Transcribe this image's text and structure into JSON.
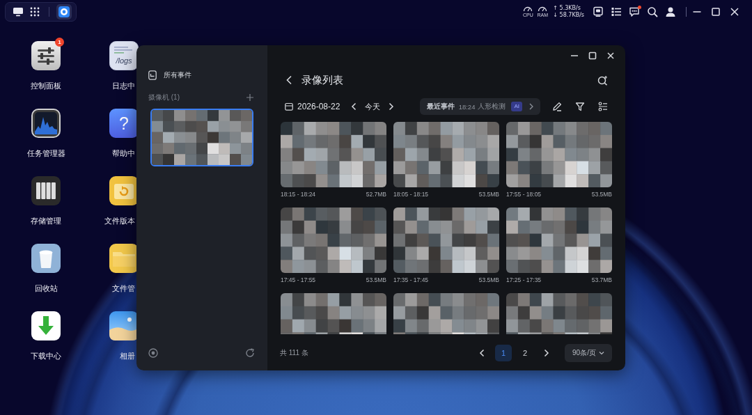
{
  "top_bar": {
    "cpu_label": "CPU",
    "ram_label": "RAM",
    "upload_speed": "↑ 5.3KB/s",
    "download_speed": "↓ 58.7KB/s",
    "messages_unread": true
  },
  "desktop": {
    "columns": [
      {
        "apps": [
          {
            "kind": "settings",
            "label": "控制面板",
            "badge": "1"
          },
          {
            "kind": "monitor",
            "label": "任务管理器"
          },
          {
            "kind": "storage",
            "label": "存储管理"
          },
          {
            "kind": "trash",
            "label": "回收站"
          },
          {
            "kind": "download",
            "label": "下载中心"
          }
        ]
      },
      {
        "apps": [
          {
            "kind": "logs",
            "label": "日志中",
            "icon_text": "/logs"
          },
          {
            "kind": "help",
            "label": "帮助中",
            "icon_text": "?"
          },
          {
            "kind": "versions",
            "label": "文件版本"
          },
          {
            "kind": "files",
            "label": "文件管"
          },
          {
            "kind": "photos",
            "label": "相册"
          }
        ]
      }
    ]
  },
  "window": {
    "sidebar": {
      "all_events": "所有事件",
      "camera_heading": "摄像机 (1)",
      "cameras": [
        {
          "selected": true
        }
      ]
    },
    "main": {
      "title": "录像列表",
      "date": "2026-08-22",
      "today": "今天",
      "recent_event": {
        "label": "最近事件",
        "time": "18:24",
        "type": "人形检测",
        "badge": "AI"
      },
      "recordings": [
        {
          "time": "18:15 - 18:24",
          "size": "52.7MB",
          "cut_off": false
        },
        {
          "time": "18:05 - 18:15",
          "size": "53.5MB",
          "cut_off": false
        },
        {
          "time": "17:55 - 18:05",
          "size": "53.5MB",
          "cut_off": false
        },
        {
          "time": "17:45 - 17:55",
          "size": "53.5MB",
          "cut_off": false
        },
        {
          "time": "17:35 - 17:45",
          "size": "53.5MB",
          "cut_off": false
        },
        {
          "time": "17:25 - 17:35",
          "size": "53.7MB",
          "cut_off": false
        },
        {
          "cut_off": true
        },
        {
          "cut_off": true
        },
        {
          "cut_off": true
        }
      ],
      "footer": {
        "total": "共 111 条",
        "pages": [
          {
            "label": "1",
            "selected": true
          },
          {
            "label": "2",
            "selected": false
          }
        ],
        "page_size": "90条/页"
      }
    }
  }
}
